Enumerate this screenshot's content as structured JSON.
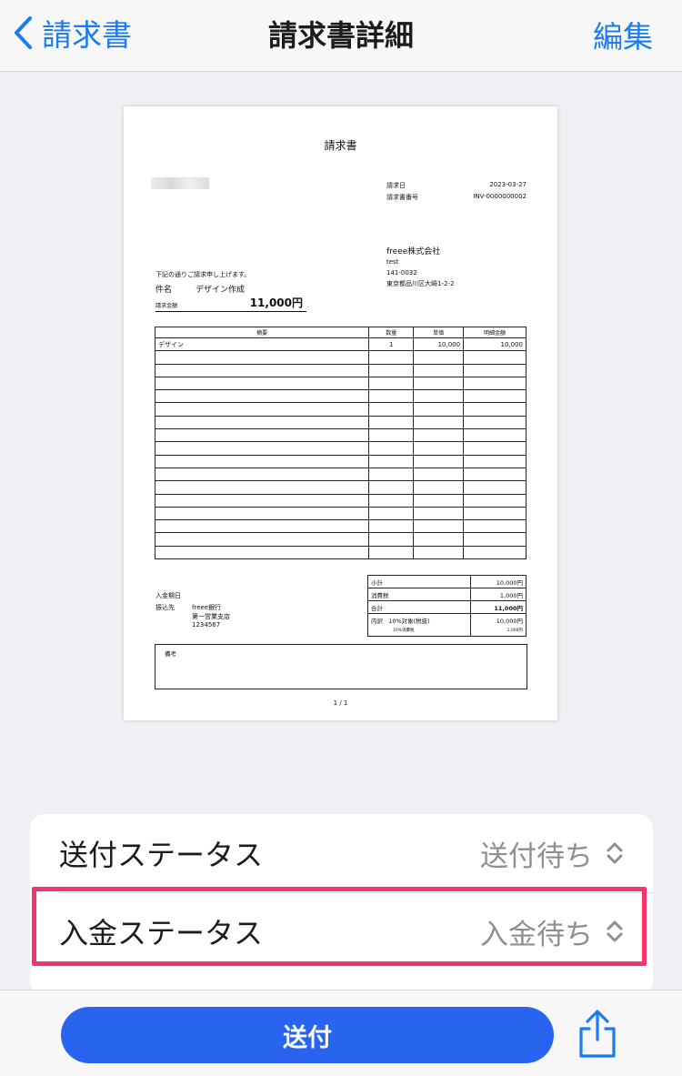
{
  "nav": {
    "back_label": "請求書",
    "title": "請求書詳細",
    "edit_label": "編集"
  },
  "invoice": {
    "title": "請求書",
    "issue_date_label": "請求日",
    "issue_date": "2023-03-27",
    "invoice_no_label": "請求書番号",
    "invoice_no": "INV-0000000002",
    "issuer": {
      "name": "freee株式会社",
      "person": "test",
      "postal": "141-0032",
      "address": "東京都品川区大崎1-2-2"
    },
    "intro": "下記の通りご請求申し上げます。",
    "subject_label": "件名",
    "subject": "デザイン作成",
    "amount_label": "請求金額",
    "amount": "11,000円",
    "table_headers": [
      "摘要",
      "数量",
      "単価",
      "明細金額"
    ],
    "items": [
      {
        "desc": "デザイン",
        "qty": "1",
        "unit": "10,000",
        "amount": "10,000"
      }
    ],
    "empty_rows": 16,
    "payment_due_label": "入金期日",
    "bank_label": "振込先",
    "bank_name": "freee銀行",
    "bank_branch": "第一営業支店",
    "bank_account": "1234567",
    "totals": {
      "subtotal_label": "小計",
      "subtotal": "10,000円",
      "tax_label": "消費税",
      "tax": "1,000円",
      "total_label": "合計",
      "total": "11,000円",
      "breakdown_label": "内訳",
      "breakdown_rate": "10%対象(税抜)",
      "breakdown_value": "10,000円",
      "breakdown_tax_label": "10%消費税",
      "breakdown_tax": "1,000円"
    },
    "remarks_label": "備考",
    "page": "1 / 1"
  },
  "status": {
    "send_label": "送付ステータス",
    "send_value": "送付待ち",
    "payment_label": "入金ステータス",
    "payment_value": "入金待ち"
  },
  "bottom": {
    "send_button": "送付"
  },
  "icons": {
    "back": "chevron-left-icon",
    "selector": "chevron-up-down-icon",
    "share": "share-icon"
  },
  "colors": {
    "accent": "#1a7cf2",
    "button": "#2864f0",
    "highlight": "#f7336c"
  }
}
